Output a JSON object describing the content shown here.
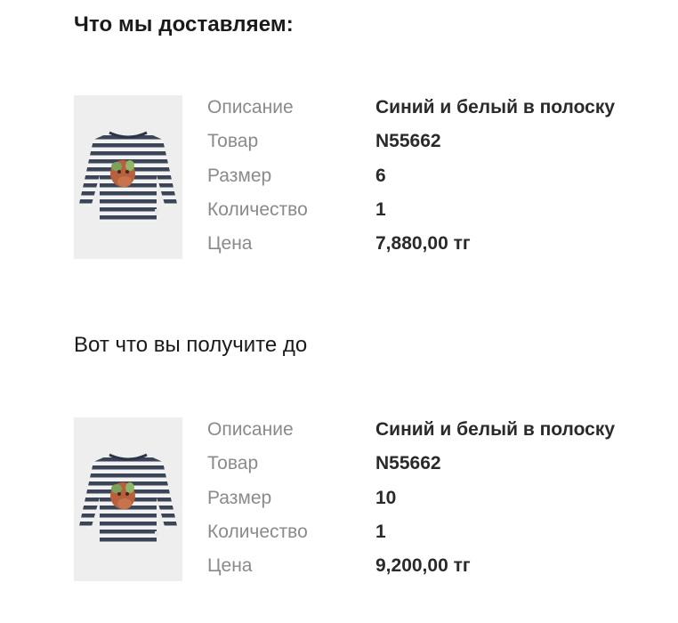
{
  "sections": [
    {
      "heading": "Что мы доставляем:",
      "product": {
        "image_icon": "striped-longsleeve-shirt",
        "rows": [
          {
            "label": "Описание",
            "value": "Синий и белый в полоску"
          },
          {
            "label": "Товар",
            "value": "N55662"
          },
          {
            "label": "Размер",
            "value": "6"
          },
          {
            "label": "Количество",
            "value": "1"
          },
          {
            "label": "Цена",
            "value": "7,880,00 тг"
          }
        ]
      }
    },
    {
      "heading": "Вот что вы получите до",
      "product": {
        "image_icon": "striped-longsleeve-shirt",
        "rows": [
          {
            "label": "Описание",
            "value": "Синий и белый в полоску"
          },
          {
            "label": "Товар",
            "value": "N55662"
          },
          {
            "label": "Размер",
            "value": "10"
          },
          {
            "label": "Количество",
            "value": "1"
          },
          {
            "label": "Цена",
            "value": "9,200,00 тг"
          }
        ]
      }
    }
  ],
  "colors": {
    "stripe_dark": "#3c4557",
    "stripe_light": "#f2f2f2",
    "image_background": "#eeeeee",
    "label_gray": "#8a8a8a",
    "value_dark": "#2a2a2a"
  }
}
